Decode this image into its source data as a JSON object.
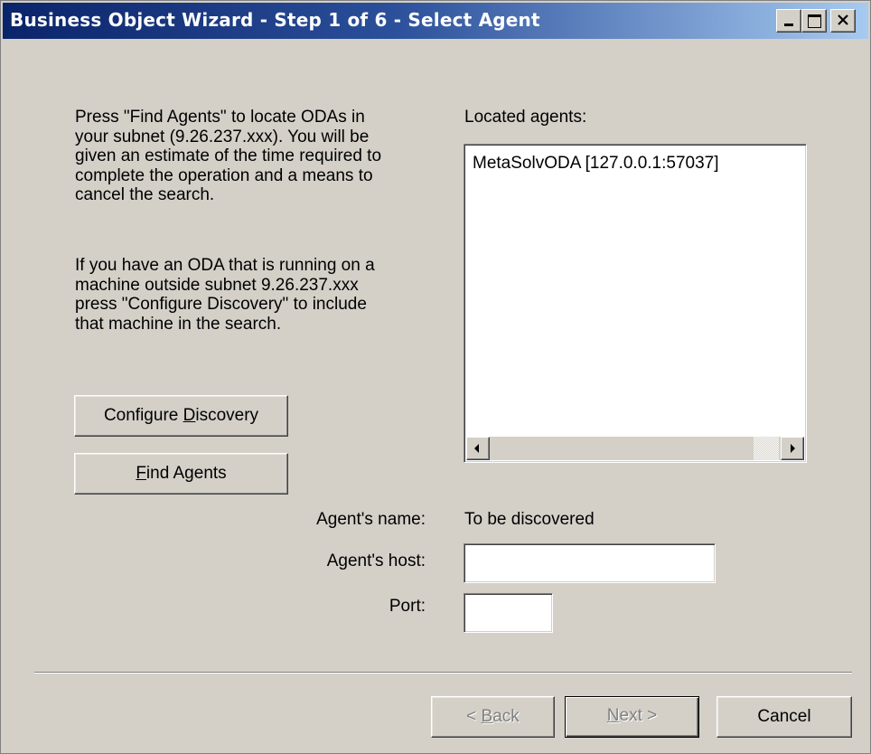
{
  "window": {
    "title": "Business Object Wizard - Step 1 of 6 - Select Agent"
  },
  "instructions": {
    "paragraph1": "Press \"Find Agents\" to locate ODAs in your subnet (9.26.237.xxx). You will be given an estimate of the time required to complete the operation and a means to cancel the search.",
    "paragraph2": "If you have an ODA that is running on a machine outside subnet 9.26.237.xxx press \"Configure Discovery\" to include that machine in the search."
  },
  "buttons": {
    "configure": {
      "before": "Configure ",
      "mnemonic": "D",
      "after": "iscovery"
    },
    "find": {
      "before": "",
      "mnemonic": "F",
      "after": "ind Agents"
    },
    "back": {
      "before": "< ",
      "mnemonic": "B",
      "after": "ack"
    },
    "next": {
      "before": "",
      "mnemonic": "N",
      "after": "ext >"
    },
    "cancel": "Cancel"
  },
  "agents": {
    "label": "Located agents:",
    "items": [
      "MetaSolvODA [127.0.0.1:57037]"
    ]
  },
  "fields": {
    "name_label": "Agent's name:",
    "name_value": "To be discovered",
    "host_label": "Agent's host:",
    "host_value": "",
    "port_label": "Port:",
    "port_value": ""
  }
}
